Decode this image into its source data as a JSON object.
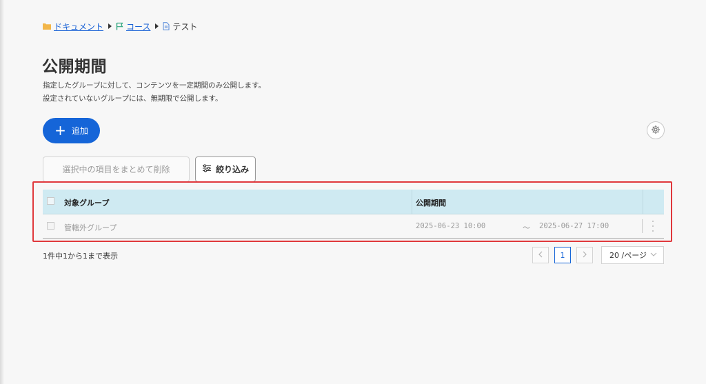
{
  "breadcrumb": {
    "items": [
      {
        "label": "ドキュメント",
        "icon": "folder-icon"
      },
      {
        "label": "コース",
        "icon": "flag-icon"
      },
      {
        "label": "テスト",
        "icon": "document-icon"
      }
    ]
  },
  "page": {
    "title": "公開期間",
    "description_line1": "指定したグループに対して、コンテンツを一定期間のみ公開します。",
    "description_line2": "設定されていないグループには、無期限で公開します。"
  },
  "toolbar": {
    "add_label": "追加",
    "bulk_delete_label": "選択中の項目をまとめて削除",
    "filter_label": "絞り込み"
  },
  "table": {
    "headers": {
      "group": "対象グループ",
      "period": "公開期間"
    },
    "rows": [
      {
        "group": "管轄外グループ",
        "start": "2025-06-23 10:00",
        "separator": "～",
        "end": "2025-06-27 17:00"
      }
    ]
  },
  "footer": {
    "count_text": "1件中1から1まで表示",
    "current_page": "1",
    "page_size": "20 /ページ"
  },
  "colors": {
    "accent": "#1565d8",
    "header_bg": "#cfeaf2",
    "highlight": "#e0383c",
    "background": "#f7f7f7"
  }
}
